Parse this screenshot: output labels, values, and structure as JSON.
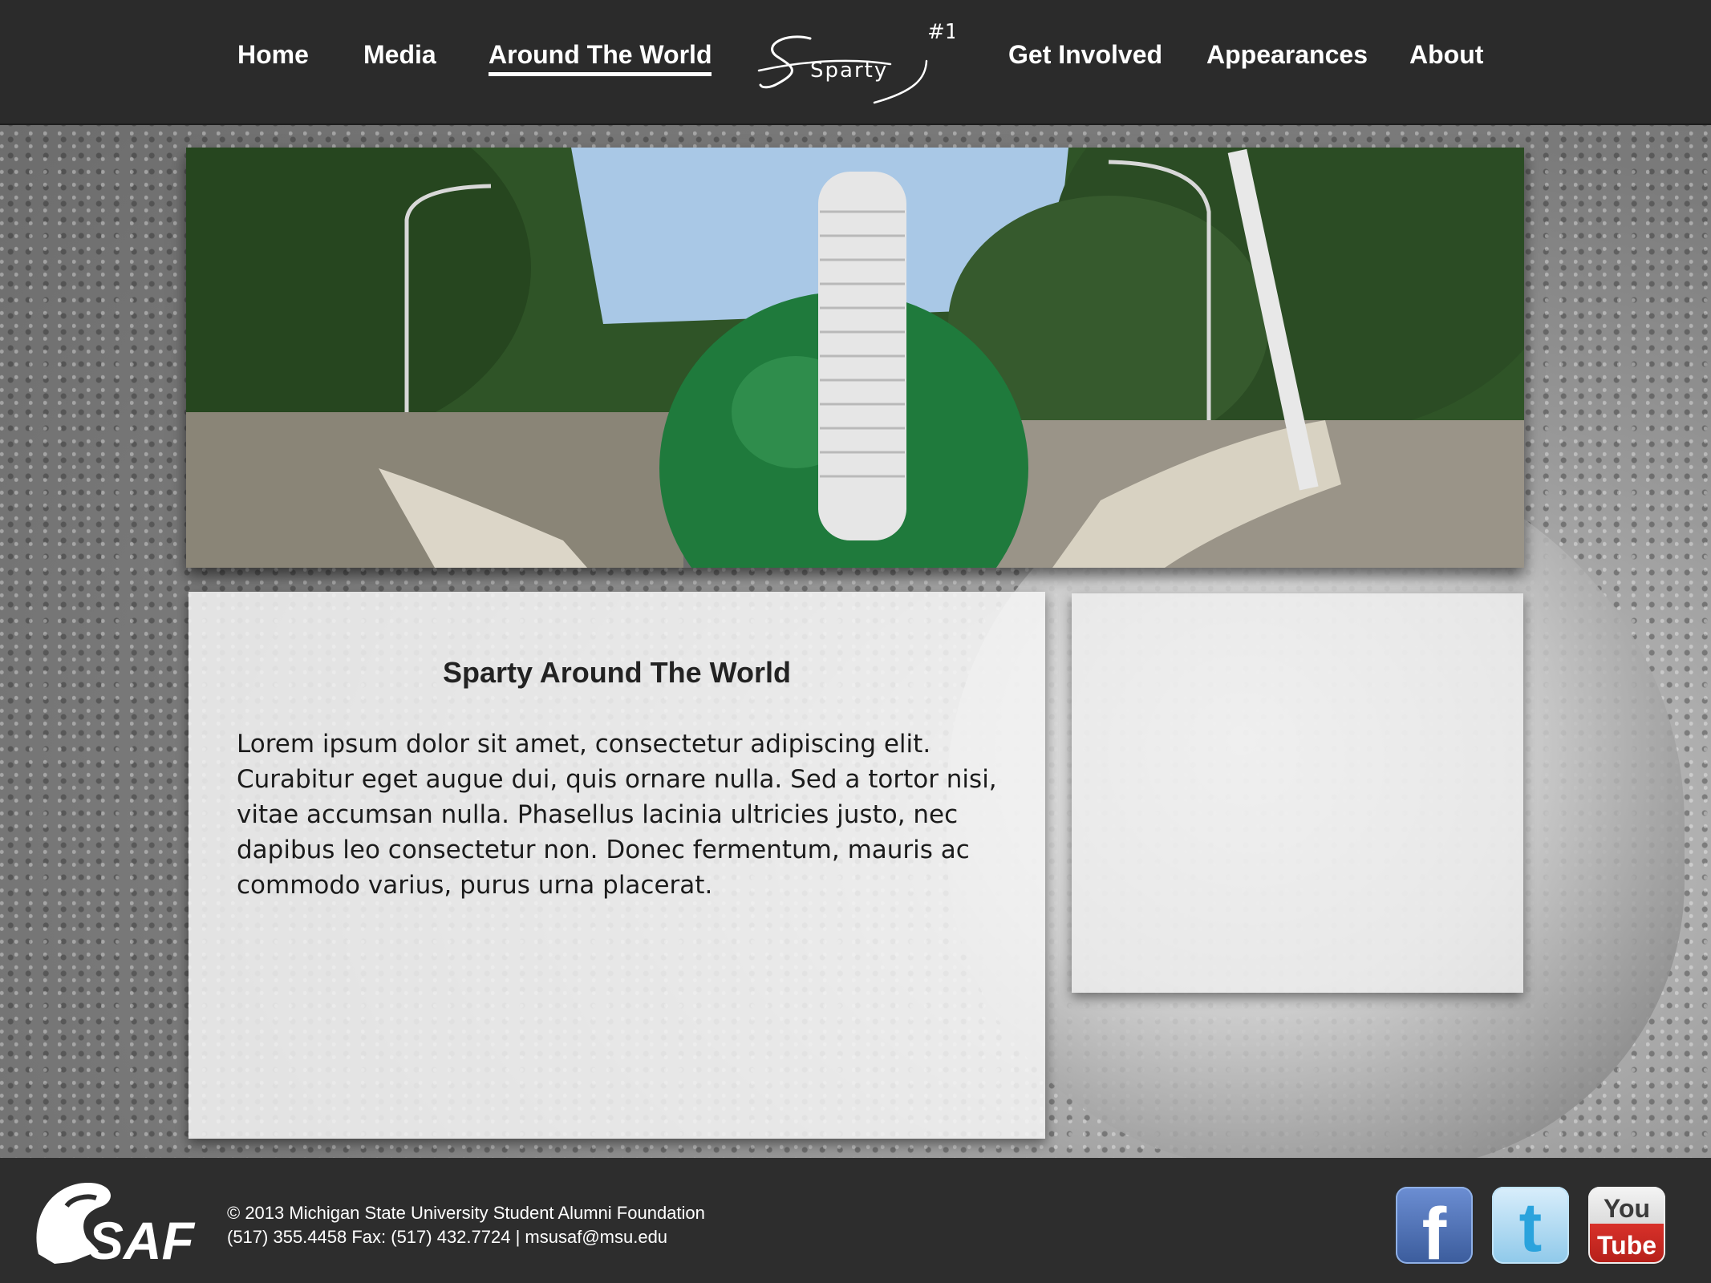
{
  "nav": {
    "items": [
      {
        "label": "Home",
        "active": false
      },
      {
        "label": "Media",
        "active": false
      },
      {
        "label": "Around The World",
        "active": true
      },
      {
        "label": "Get Involved",
        "active": false
      },
      {
        "label": "Appearances",
        "active": false
      },
      {
        "label": "About",
        "active": false
      }
    ],
    "logo_text": "Sparty",
    "logo_badge": "#1"
  },
  "hero": {
    "image": "sparty-parade-photo"
  },
  "main": {
    "title": "Sparty Around The World",
    "body": "Lorem ipsum dolor sit amet, consectetur adipiscing elit. Curabitur eget augue dui, quis ornare nulla. Sed a tortor nisi, vitae accumsan nulla. Phasellus lacinia ultricies justo, nec dapibus leo consectetur non. Donec fermentum, mauris ac commodo varius, purus urna placerat."
  },
  "footer": {
    "logo_text": "SAF",
    "copyright": "© 2013 Michigan State University Student Alumni Foundation",
    "contact": "(517) 355.4458 Fax: (517) 432.7724 | msusaf@msu.edu",
    "social": [
      {
        "name": "facebook-icon",
        "label": "f"
      },
      {
        "name": "twitter-icon",
        "label": "t"
      },
      {
        "name": "youtube-icon",
        "label_top": "You",
        "label_bottom": "Tube"
      }
    ]
  },
  "colors": {
    "nav_bg": "#2b2b2b",
    "footer_bg": "#2d2d2d",
    "msu_green": "#1d6b3a",
    "panel_bg": "#f4f4f4"
  }
}
